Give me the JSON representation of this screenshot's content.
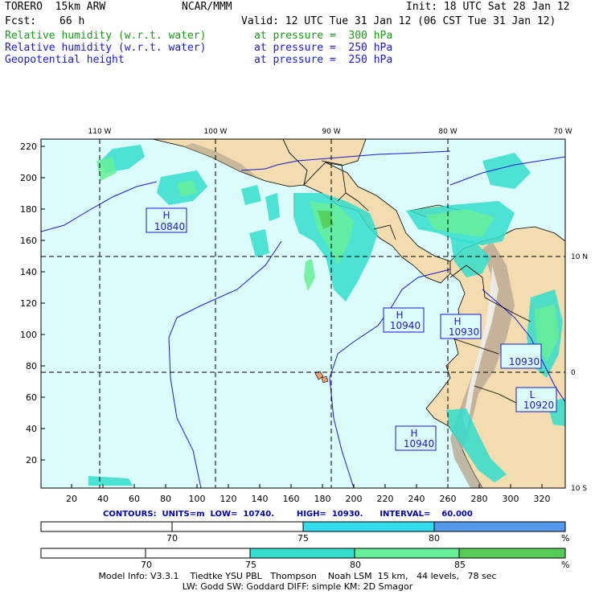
{
  "header": {
    "model": "TORERO  15km ARW",
    "center": "NCAR/MMM",
    "init": "Init: 18 UTC Sat 28 Jan 12",
    "fcst_label": "Fcst:",
    "fcst_value": "66 h",
    "valid": "Valid: 12 UTC Tue 31 Jan 12 (06 CST Tue 31 Jan 12)",
    "fields": [
      {
        "name": "Relative humidity (w.r.t. water)",
        "level": "at pressure =  300 hPa",
        "color": "#1a9a1a"
      },
      {
        "name": "Relative humidity (w.r.t. water)",
        "level": "at pressure =  250 hPa",
        "color": "#1a1acc"
      },
      {
        "name": "Geopotential height",
        "level": "at pressure =  250 hPa",
        "color": "#1a1acc"
      }
    ]
  },
  "map": {
    "lon_labels": [
      "110 W",
      "100 W",
      "90 W",
      "80 W",
      "70 W"
    ],
    "lat_labels": [
      "10 N",
      "0",
      "10 S"
    ],
    "y_ticks": [
      "220",
      "200",
      "180",
      "160",
      "140",
      "120",
      "100",
      "80",
      "60",
      "40",
      "20"
    ],
    "x_ticks": [
      "20",
      "40",
      "60",
      "80",
      "100",
      "120",
      "140",
      "160",
      "180",
      "200",
      "220",
      "240",
      "260",
      "280",
      "300",
      "320"
    ],
    "centers": [
      {
        "type": "H",
        "value": "10840"
      },
      {
        "type": "H",
        "value": "10940"
      },
      {
        "type": "H",
        "value": "10930"
      },
      {
        "type": "H",
        "value": "10930"
      },
      {
        "type": "L",
        "value": "10920"
      },
      {
        "type": "H",
        "value": "10940"
      }
    ],
    "ocean_color": "#dcfbfb",
    "land_color": "#f2dcb0"
  },
  "contours": {
    "text": "CONTOURS:  UNITS=m  LOW=  10740.        HIGH=  10930.      INTERVAL=    60.000"
  },
  "colorbar1": {
    "labels": [
      "70",
      "75",
      "80"
    ],
    "unit": "%",
    "colors": [
      "#ffffff",
      "#ffffff",
      "#33ddee",
      "#5599ee"
    ]
  },
  "colorbar2": {
    "labels": [
      "70",
      "75",
      "80",
      "85"
    ],
    "unit": "%",
    "colors": [
      "#ffffff",
      "#ffffff",
      "#33ddcc",
      "#66ee99",
      "#55cc55"
    ]
  },
  "footer": {
    "line1": "Model Info: V3.3.1    Tiedtke YSU PBL   Thompson    Noah LSM  15 km,   44 levels,   78 sec",
    "line2": "LW: Godd SW: Goddard DIFF: simple KM: 2D Smagor"
  }
}
